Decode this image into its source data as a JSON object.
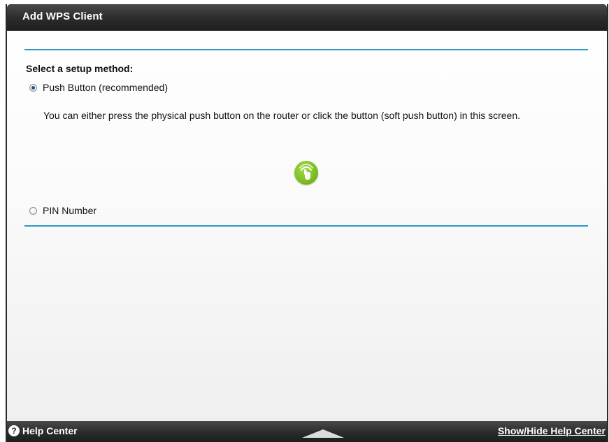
{
  "header": {
    "title": "Add WPS Client"
  },
  "setup": {
    "label": "Select a setup method:",
    "options": [
      {
        "label": "Push Button (recommended)",
        "selected": true
      },
      {
        "label": "PIN Number",
        "selected": false
      }
    ],
    "push_description": "You can either press the physical push button on the router or click the button (soft push button) in this screen.",
    "wps_button_icon": "wps-push-icon"
  },
  "footer": {
    "help_label": "Help Center",
    "help_icon": "question-icon",
    "toggle_icon": "chevron-up-icon",
    "show_hide_label": "Show/Hide Help Center"
  },
  "colors": {
    "accent_rule": "#2c9ac3",
    "header_bg": "#2b2b2b",
    "wps_green": "#7bbd22"
  }
}
